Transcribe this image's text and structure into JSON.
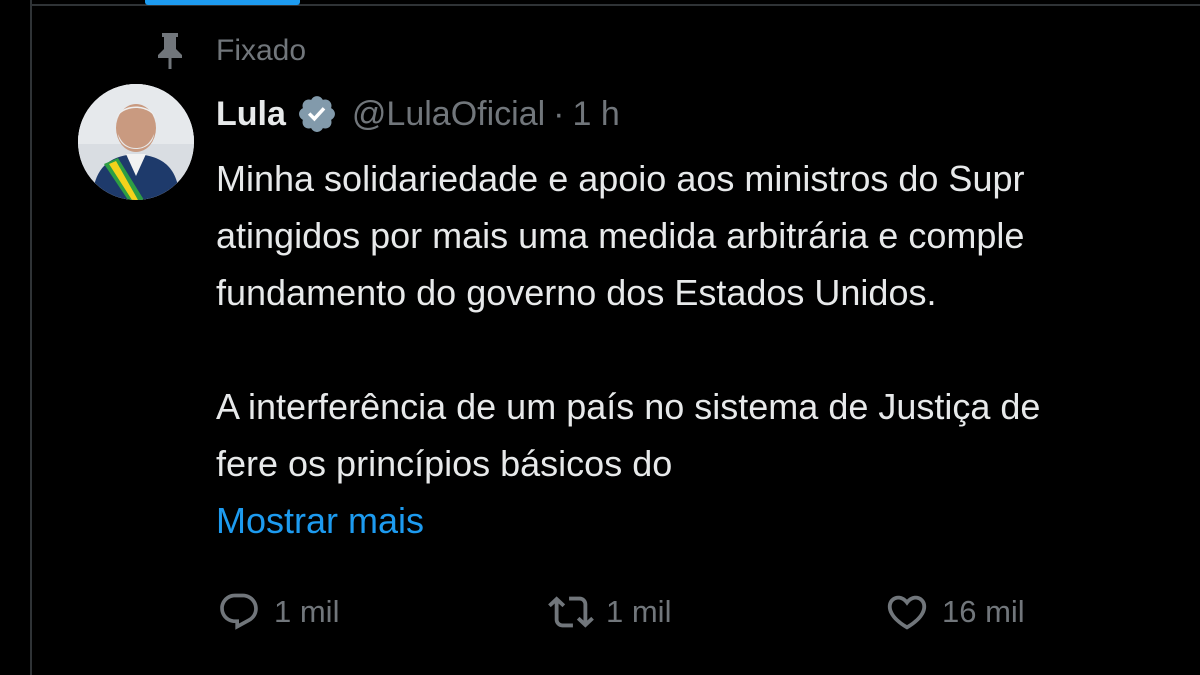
{
  "pinned": {
    "icon": "pin-icon",
    "label": "Fixado"
  },
  "tweet": {
    "author": {
      "display_name": "Lula",
      "verified_icon": "verified-badge-icon",
      "handle": "@LulaOficial",
      "separator": "·",
      "time": "1 h"
    },
    "text_lines": [
      "Minha solidariedade e apoio aos ministros do Supr",
      "atingidos por mais uma medida arbitrária e comple",
      "fundamento do governo dos Estados Unidos.",
      "",
      "A interferência de um país no sistema de Justiça de",
      "fere os princípios básicos do"
    ],
    "show_more": "Mostrar mais",
    "actions": {
      "replies": {
        "icon": "reply-icon",
        "count": "1 mil"
      },
      "reposts": {
        "icon": "repost-icon",
        "count": "1 mil"
      },
      "likes": {
        "icon": "heart-icon",
        "count": "16 mil"
      }
    }
  },
  "colors": {
    "background": "#000000",
    "text_primary": "#e7e9ea",
    "text_secondary": "#71767b",
    "accent": "#1d9bf0",
    "verified_badge": "#829aab",
    "border": "#2f3336"
  }
}
